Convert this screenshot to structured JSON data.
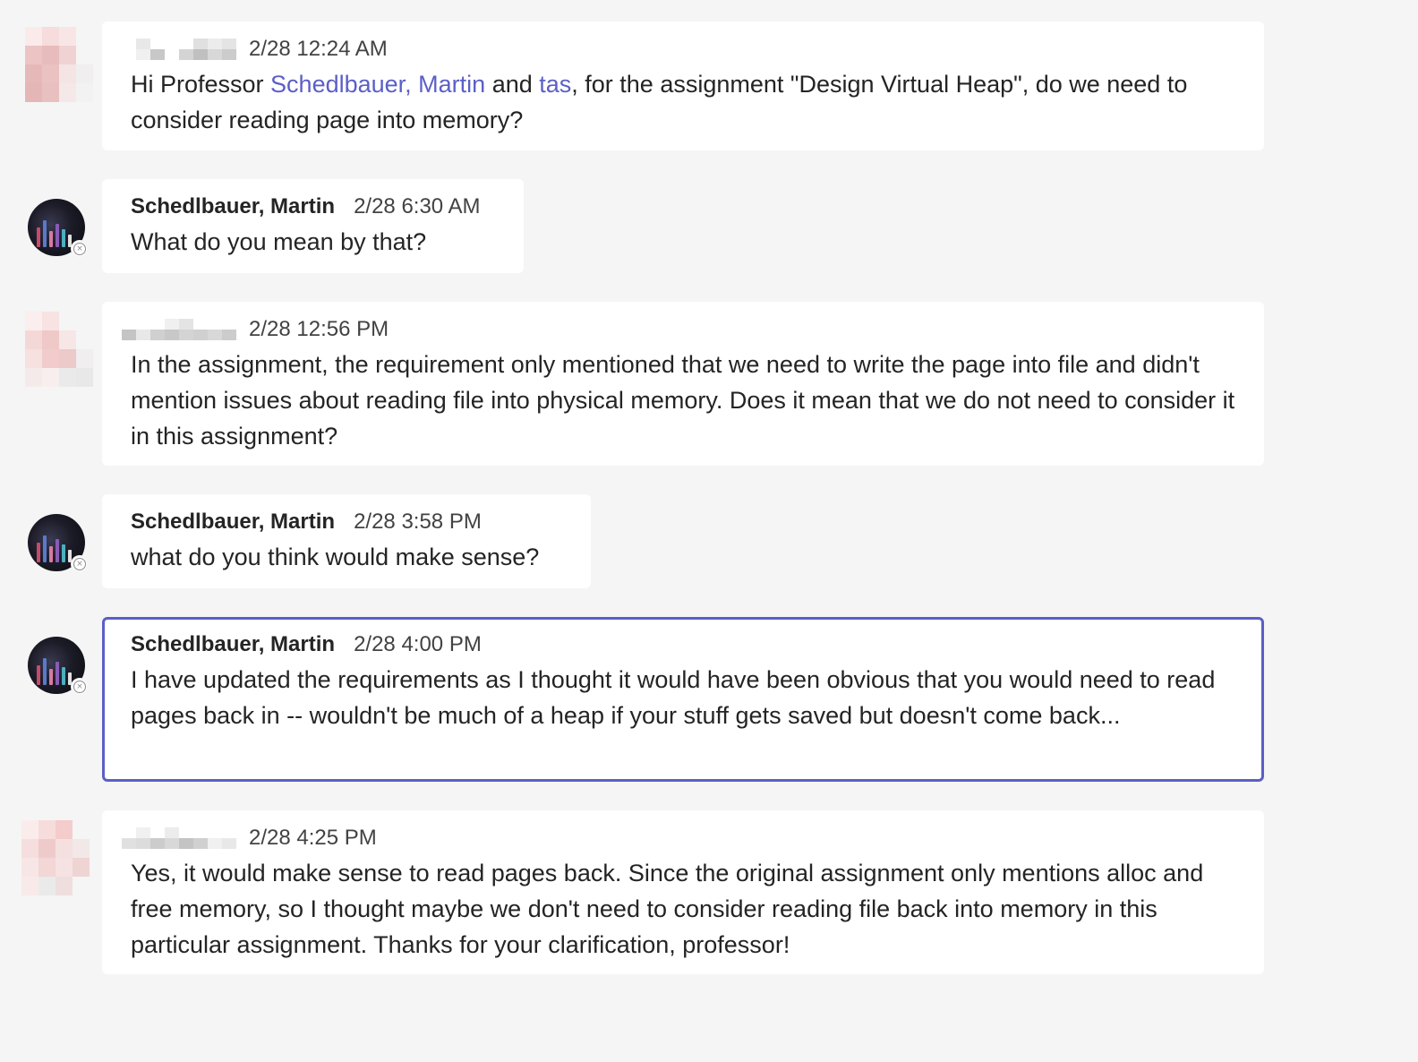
{
  "colors": {
    "background": "#f5f5f5",
    "bubble": "#ffffff",
    "mention": "#5b5fc7",
    "selected_border": "#5b5fc7"
  },
  "messages": [
    {
      "timestamp": "2/28 12:24 AM",
      "text_before": "Hi Professor ",
      "mention1": "Schedlbauer, Martin",
      "text_mid": " and ",
      "mention2": "tas",
      "text_after": ", for the assignment \"Design Virtual Heap\", do we need to consider reading page into memory?"
    },
    {
      "author": "Schedlbauer, Martin",
      "timestamp": "2/28 6:30 AM",
      "text": "What do you mean by that?",
      "status_icon": "offline-status-icon"
    },
    {
      "timestamp": "2/28 12:56 PM",
      "text": "In the assignment, the requirement only mentioned that we need to write the page into file and didn't mention issues about reading file into physical memory. Does it mean that we do not need to consider it in this assignment?"
    },
    {
      "author": "Schedlbauer, Martin",
      "timestamp": "2/28 3:58 PM",
      "text": "what do you think would make sense?",
      "status_icon": "offline-status-icon"
    },
    {
      "author": "Schedlbauer, Martin",
      "timestamp": "2/28 4:00 PM",
      "text": "I have updated the requirements as I thought it would have been obvious that you would need to read pages back in -- wouldn't be much of a heap if your stuff gets saved but doesn't come back...",
      "status_icon": "offline-status-icon",
      "selected": true
    },
    {
      "timestamp": "2/28 4:25 PM",
      "text": "Yes, it would make sense to read pages back. Since the original assignment only mentions alloc and free memory, so I thought maybe we don't need to consider reading file back into memory in this particular assignment. Thanks for your clarification, professor!"
    }
  ]
}
